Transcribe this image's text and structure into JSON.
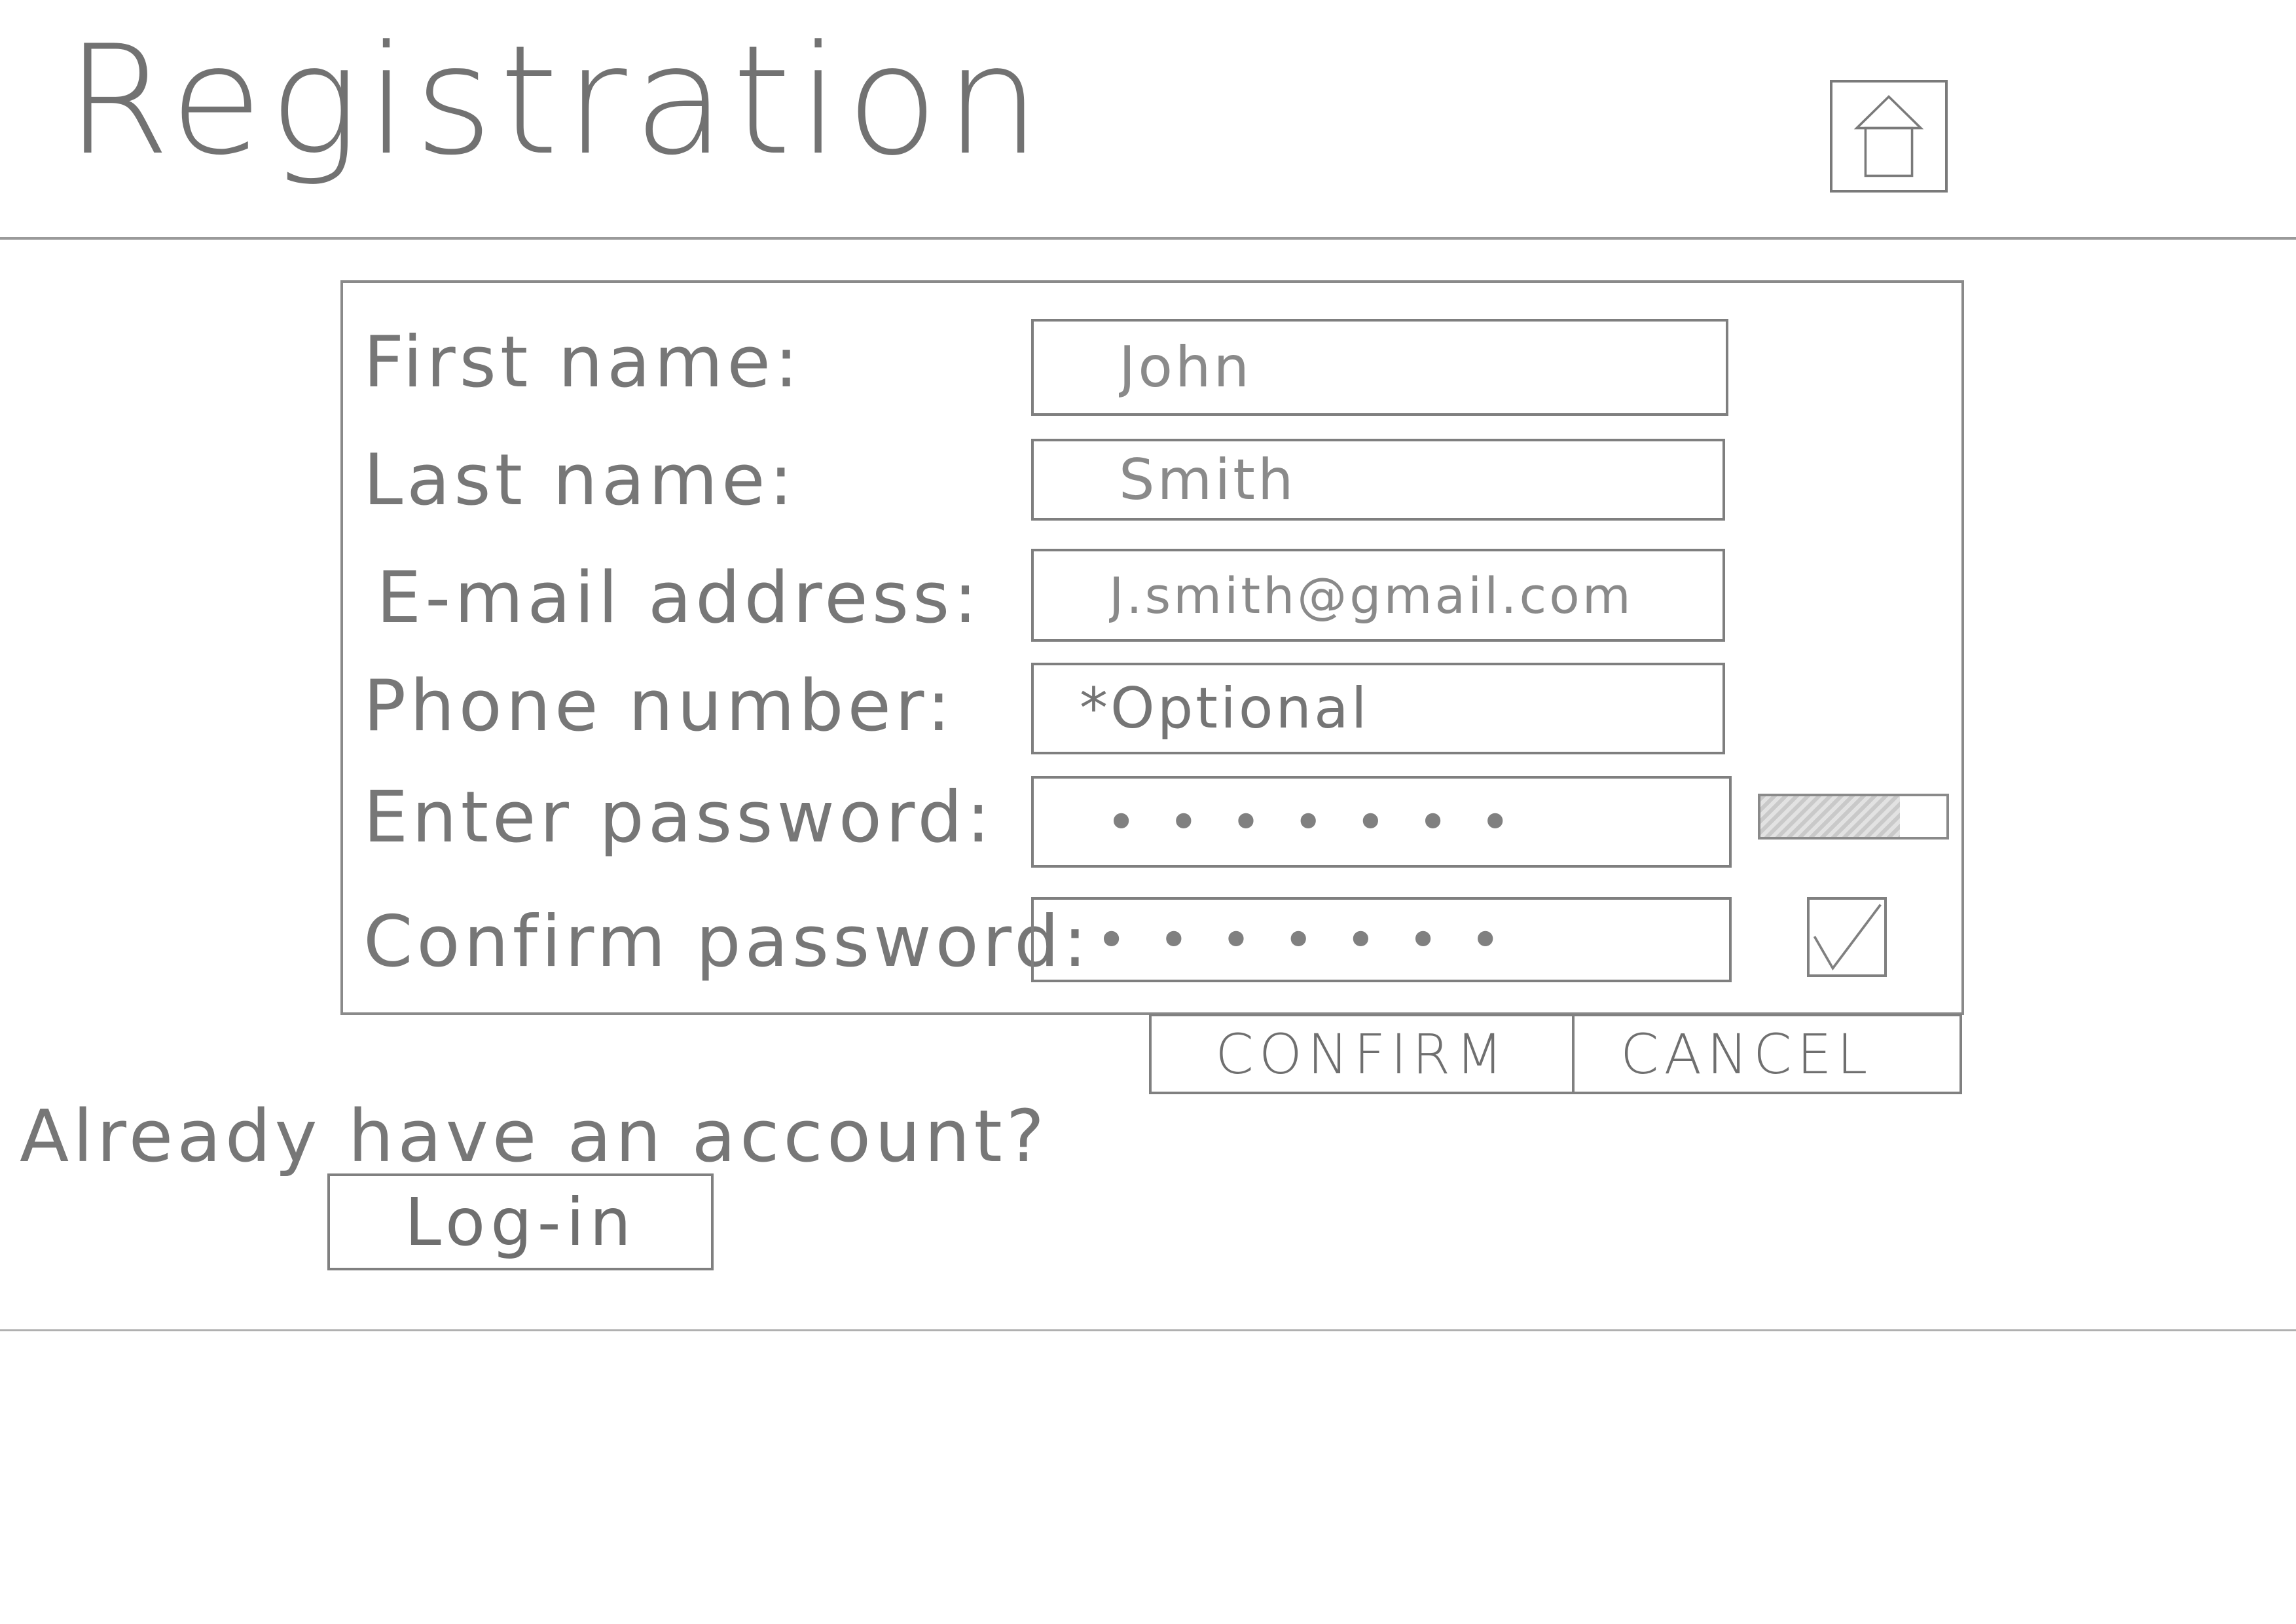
{
  "header": {
    "title": "Registration",
    "home_icon": "home-icon"
  },
  "form": {
    "fields": [
      {
        "label": "First name:",
        "value": "John"
      },
      {
        "label": "Last name:",
        "value": "Smith"
      },
      {
        "label": "E-mail address:",
        "value": "J.smith@gmail.com"
      },
      {
        "label": "Phone number:",
        "value": "*Optional"
      },
      {
        "label": "Enter password:",
        "value": "•••••••"
      },
      {
        "label": "Confirm password:",
        "value": "•••••••"
      }
    ],
    "password_strength": 0.75,
    "passwords_match": true,
    "match_icon": "checkmark-icon"
  },
  "actions": {
    "confirm_label": "CONFIRM",
    "cancel_label": "CANCEL"
  },
  "login": {
    "prompt": "Already have an account?",
    "button_label": "Log-in"
  }
}
